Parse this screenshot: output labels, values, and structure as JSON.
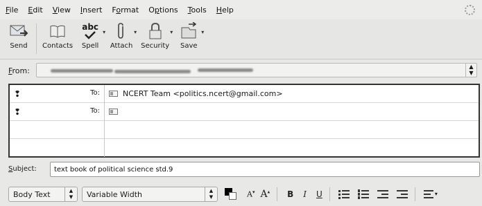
{
  "menubar": {
    "items": [
      {
        "mnemonic": "F",
        "rest": "ile"
      },
      {
        "mnemonic": "E",
        "rest": "dit"
      },
      {
        "mnemonic": "V",
        "rest": "iew"
      },
      {
        "mnemonic": "I",
        "rest": "nsert"
      },
      {
        "pre": "F",
        "mnemonic": "o",
        "rest": "rmat"
      },
      {
        "pre": "O",
        "mnemonic": "p",
        "rest": "tions"
      },
      {
        "mnemonic": "T",
        "rest": "ools"
      },
      {
        "mnemonic": "H",
        "rest": "elp"
      }
    ]
  },
  "toolbar": {
    "send": "Send",
    "contacts": "Contacts",
    "spell": "Spell",
    "attach": "Attach",
    "security": "Security",
    "save": "Save",
    "spell_glyph": "abc"
  },
  "from": {
    "label_mnemonic": "F",
    "label_rest": "rom:"
  },
  "recipients": {
    "rows": [
      {
        "type": "To:",
        "address": "NCERT Team <politics.ncert@gmail.com>"
      },
      {
        "type": "To:",
        "address": ""
      }
    ]
  },
  "subject": {
    "label_mnemonic": "S",
    "label_rest": "ubject:",
    "value": "text book of political science std.9"
  },
  "formatbar": {
    "paragraph_style": "Body Text",
    "font": "Variable Width",
    "smaller": "A",
    "larger": "A",
    "bold": "B",
    "italic": "I",
    "underline": "U",
    "text_color": "#000000",
    "background_color": "#ffffff"
  }
}
